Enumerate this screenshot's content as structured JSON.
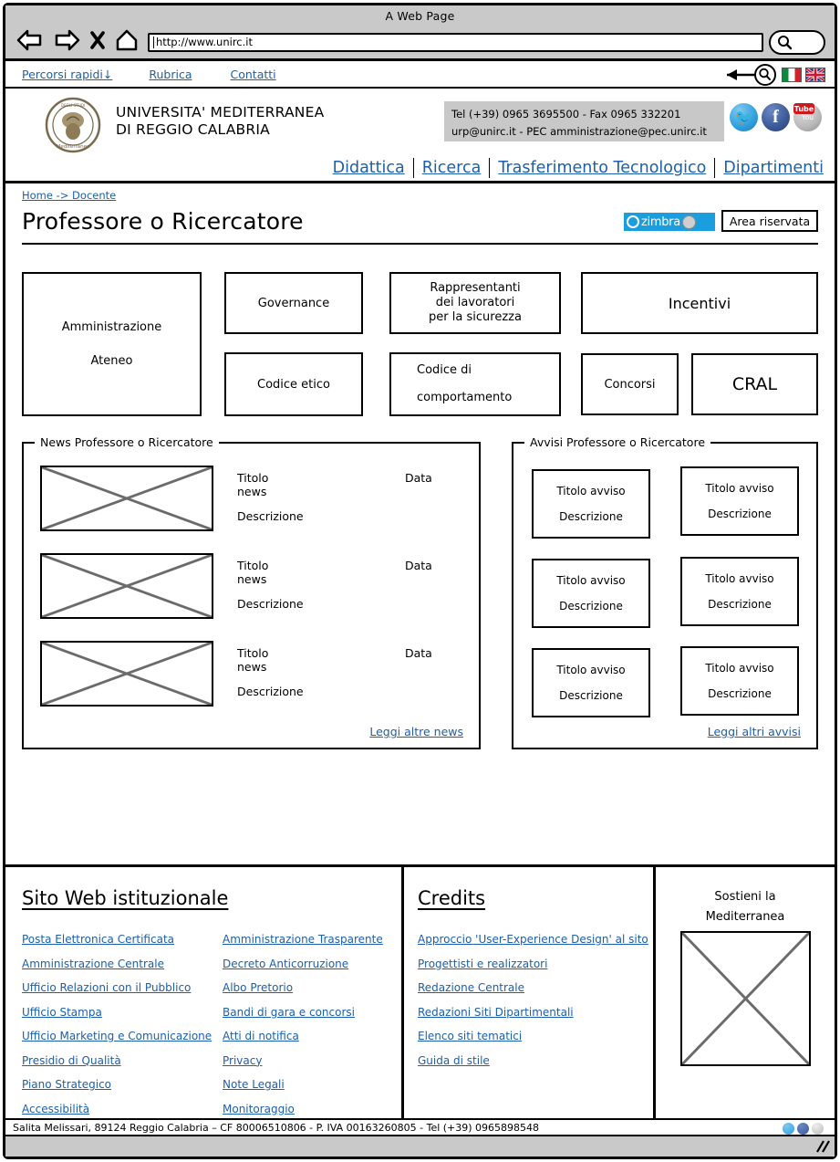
{
  "browser": {
    "window_title": "A Web Page",
    "url": "http://www.unirc.it",
    "back_icon": "back-arrow-icon",
    "forward_icon": "forward-arrow-icon",
    "stop_icon": "close-x-icon",
    "home_icon": "home-icon",
    "search_icon": "magnifier-icon"
  },
  "quickbar": {
    "links": [
      {
        "label": "Percorsi rapidi↓"
      },
      {
        "label": "Rubrica"
      },
      {
        "label": "Contatti"
      }
    ],
    "search_icon": "magnifier-icon",
    "flags": [
      {
        "name": "italian-flag"
      },
      {
        "name": "uk-flag"
      }
    ]
  },
  "masthead": {
    "crest_alt": "university-crest",
    "name_line1": "UNIVERSITA' MEDITERRANEA",
    "name_line2": "DI REGGIO CALABRIA",
    "contact_line1": "Tel (+39) 0965 3695500 - Fax 0965 332201",
    "contact_line2": "urp@unirc.it   - PEC amministrazione@pec.unirc.it",
    "socials": [
      {
        "name": "twitter-icon",
        "glyph": "🐦"
      },
      {
        "name": "facebook-icon",
        "glyph": "f"
      },
      {
        "name": "youtube-icon",
        "glyph": "Tube",
        "label": "You"
      }
    ]
  },
  "mainnav": {
    "items": [
      {
        "label": "Didattica"
      },
      {
        "label": "Ricerca"
      },
      {
        "label": "Trasferimento Tecnologico"
      },
      {
        "label": "Dipartimenti"
      }
    ]
  },
  "breadcrumb": "Home -> Docente",
  "title": {
    "heading": "Professore o Ricercatore",
    "zimbra_label": "zimbra",
    "area_riservata_label": "Area riservata"
  },
  "tiles": [
    {
      "label": "Amministrazione\nAteneo"
    },
    {
      "label": "Governance"
    },
    {
      "label": "Rappresentanti\ndei lavoratori\nper la sicurezza"
    },
    {
      "label": "Incentivi"
    },
    {
      "label": "Codice etico"
    },
    {
      "label": "Codice di\n\ncomportamento"
    },
    {
      "label": "Concorsi"
    },
    {
      "label": "CRAL"
    }
  ],
  "news_panel": {
    "legend": "News Professore o Ricercatore",
    "more_link": "Leggi altre news",
    "items": [
      {
        "title": "Titolo news",
        "date": "Data",
        "desc": "Descrizione",
        "thumb": "news-image-placeholder"
      },
      {
        "title": "Titolo news",
        "date": "Data",
        "desc": "Descrizione",
        "thumb": "news-image-placeholder"
      },
      {
        "title": "Titolo news",
        "date": "Data",
        "desc": "Descrizione",
        "thumb": "news-image-placeholder"
      }
    ]
  },
  "avvisi_panel": {
    "legend": "Avvisi  Professore o Ricercatore",
    "more_link": "Leggi altri avvisi",
    "items": [
      {
        "title": "Titolo avviso",
        "desc": "Descrizione"
      },
      {
        "title": "Titolo avviso",
        "desc": "Descrizione"
      },
      {
        "title": "Titolo avviso",
        "desc": "Descrizione"
      },
      {
        "title": "Titolo avviso",
        "desc": "Descrizione"
      },
      {
        "title": "Titolo avviso",
        "desc": "Descrizione"
      },
      {
        "title": "Titolo avviso",
        "desc": "Descrizione"
      }
    ]
  },
  "footer": {
    "sito_heading": "Sito Web istituzionale",
    "sito_col1": [
      {
        "label": "Posta Elettronica Certificata"
      },
      {
        "label": "Amministrazione Centrale"
      },
      {
        "label": "Ufficio Relazioni con il Pubblico"
      },
      {
        "label": "Ufficio Stampa"
      },
      {
        "label": "Ufficio Marketing e Comunicazione"
      },
      {
        "label": "Presidio di Qualità"
      },
      {
        "label": "Piano Strategico"
      },
      {
        "label": "Accessibilità"
      }
    ],
    "sito_col2": [
      {
        "label": "Amministrazione Trasparente"
      },
      {
        "label": "Decreto Anticorruzione"
      },
      {
        "label": "Albo Pretorio"
      },
      {
        "label": "Bandi di gara e concorsi"
      },
      {
        "label": "Atti di notifica"
      },
      {
        "label": "Privacy"
      },
      {
        "label": "Note Legali"
      },
      {
        "label": "Monitoraggio"
      }
    ],
    "credits_heading": "Credits",
    "credits_links": [
      {
        "label": "Approccio 'User-Experience Design' al sito"
      },
      {
        "label": "Progettisti e realizzatori"
      },
      {
        "label": "Redazione Centrale"
      },
      {
        "label": "Redazioni Siti Dipartimentali"
      },
      {
        "label": "Elenco siti tematici"
      },
      {
        "label": "Guida di stile"
      }
    ],
    "support_line1": "Sostieni la",
    "support_line2": "Mediterranea",
    "support_image": "support-image-placeholder",
    "status_text": "Salita Melissari, 89124 Reggio Calabria – CF 80006510806 - P. IVA  00163260805 - Tel (+39) 0965898548",
    "status_socials": [
      {
        "name": "twitter-icon"
      },
      {
        "name": "facebook-icon"
      },
      {
        "name": "youtube-icon"
      }
    ]
  },
  "colors": {
    "link": "#1c5fab",
    "chrome": "#c9c9c9",
    "zimbra": "#1a9ede",
    "contact_bg": "#c8c8c8"
  }
}
